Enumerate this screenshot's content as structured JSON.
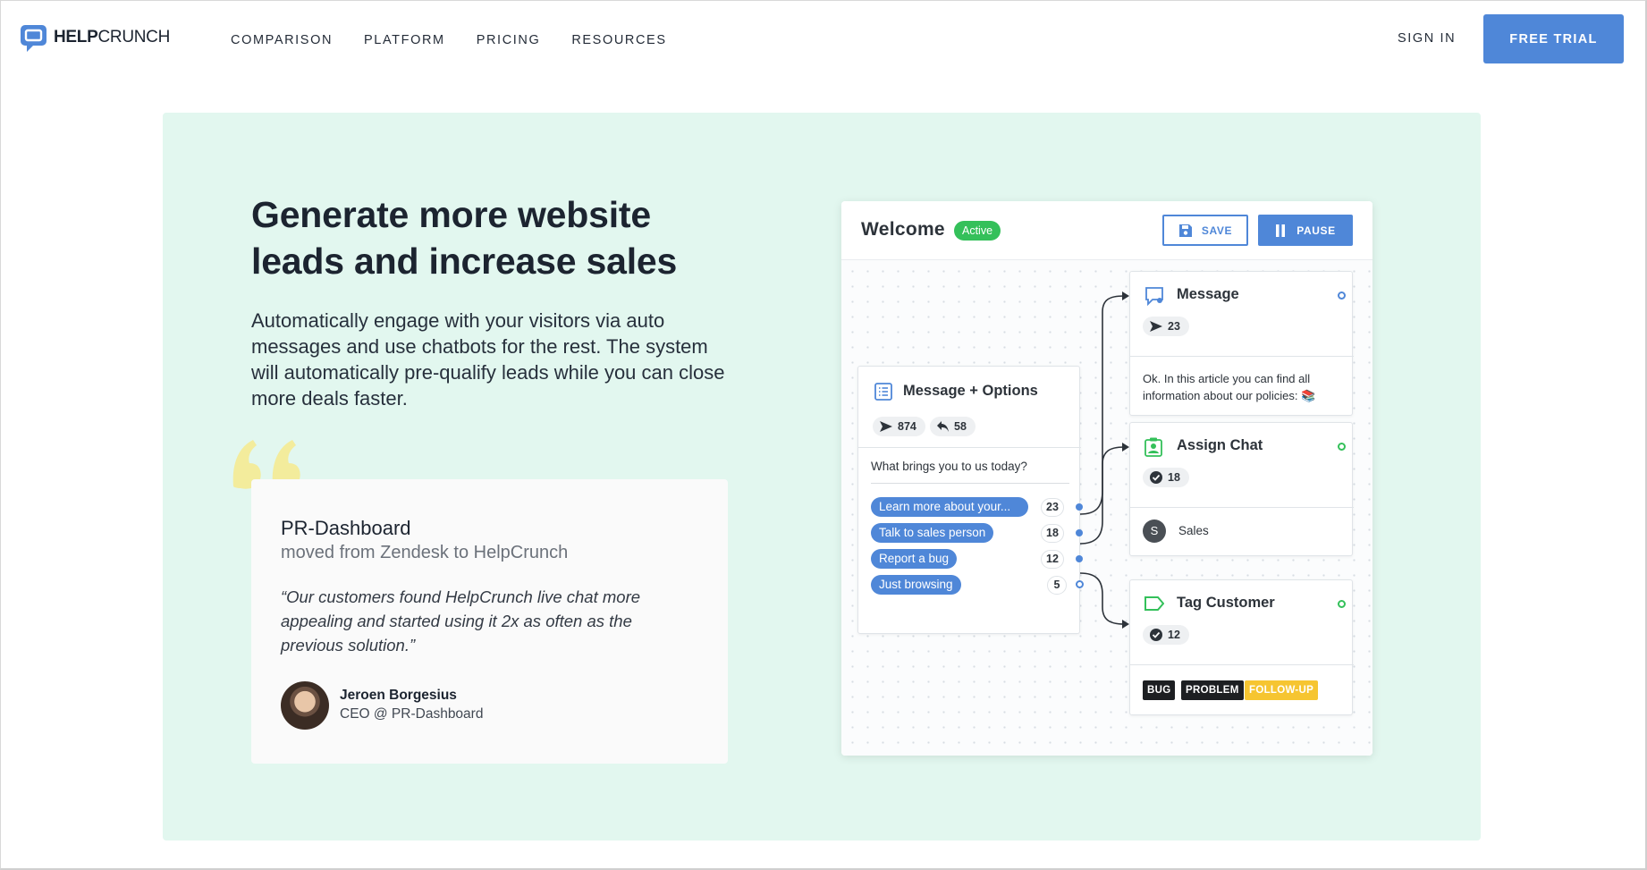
{
  "brand": {
    "name_bold": "HELP",
    "name_rest": "CRUNCH",
    "accent": "#4f87d8",
    "green": "#34c05a",
    "hero_bg": "#e2f7ef"
  },
  "nav": {
    "links": [
      "COMPARISON",
      "PLATFORM",
      "PRICING",
      "RESOURCES"
    ],
    "sign_in": "SIGN IN",
    "free_trial": "FREE TRIAL"
  },
  "hero": {
    "headline": "Generate more website leads and increase sales",
    "subtext": "Automatically engage with your visitors via auto messages and use chatbots for the rest. The system will automatically pre-qualify leads while you can close more deals faster."
  },
  "testimonial": {
    "company": "PR-Dashboard",
    "moved": "moved from Zendesk to HelpCrunch",
    "quote": "“Our customers found HelpCrunch live chat more appealing and started using it 2x as often as the previous solution.”",
    "person_name": "Jeroen Borgesius",
    "person_role": "CEO @ PR-Dashboard"
  },
  "widget": {
    "title": "Welcome",
    "status": "Active",
    "save_label": "SAVE",
    "pause_label": "PAUSE",
    "options_node": {
      "title": "Message + Options",
      "sent": "874",
      "replied": "58",
      "question": "What brings you to us today?",
      "options": [
        {
          "label": "Learn more about your...",
          "count": "23"
        },
        {
          "label": "Talk to sales person",
          "count": "18"
        },
        {
          "label": "Report a bug",
          "count": "12"
        },
        {
          "label": "Just browsing",
          "count": "5"
        }
      ]
    },
    "message_node": {
      "title": "Message",
      "sent": "23",
      "text": "Ok. In this article you can find all information about our policies: 📚"
    },
    "assign_node": {
      "title": "Assign Chat",
      "done": "18",
      "assignee_initial": "S",
      "assignee": "Sales"
    },
    "tag_node": {
      "title": "Tag Customer",
      "done": "12",
      "tags": [
        "BUG",
        "PROBLEM",
        "FOLLOW-UP"
      ]
    }
  }
}
